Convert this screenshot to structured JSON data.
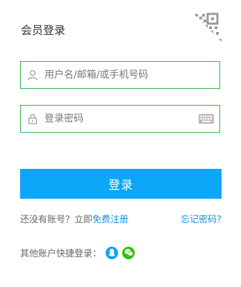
{
  "header": {
    "title": "会员登录"
  },
  "form": {
    "username_placeholder": "用户名/邮箱/或手机号码",
    "password_placeholder": "登录密码",
    "submit_label": "登录"
  },
  "links": {
    "no_account_text": "还没有账号？立即",
    "register_label": "免费注册",
    "forgot_label": "忘记密码?"
  },
  "other_login": {
    "label": "其他账户快捷登录："
  },
  "colors": {
    "accent": "#0ea6f6",
    "field_border": "#28b44b",
    "link": "#1a8fd8",
    "qq": "#16a1f0",
    "wechat": "#2dc100"
  }
}
